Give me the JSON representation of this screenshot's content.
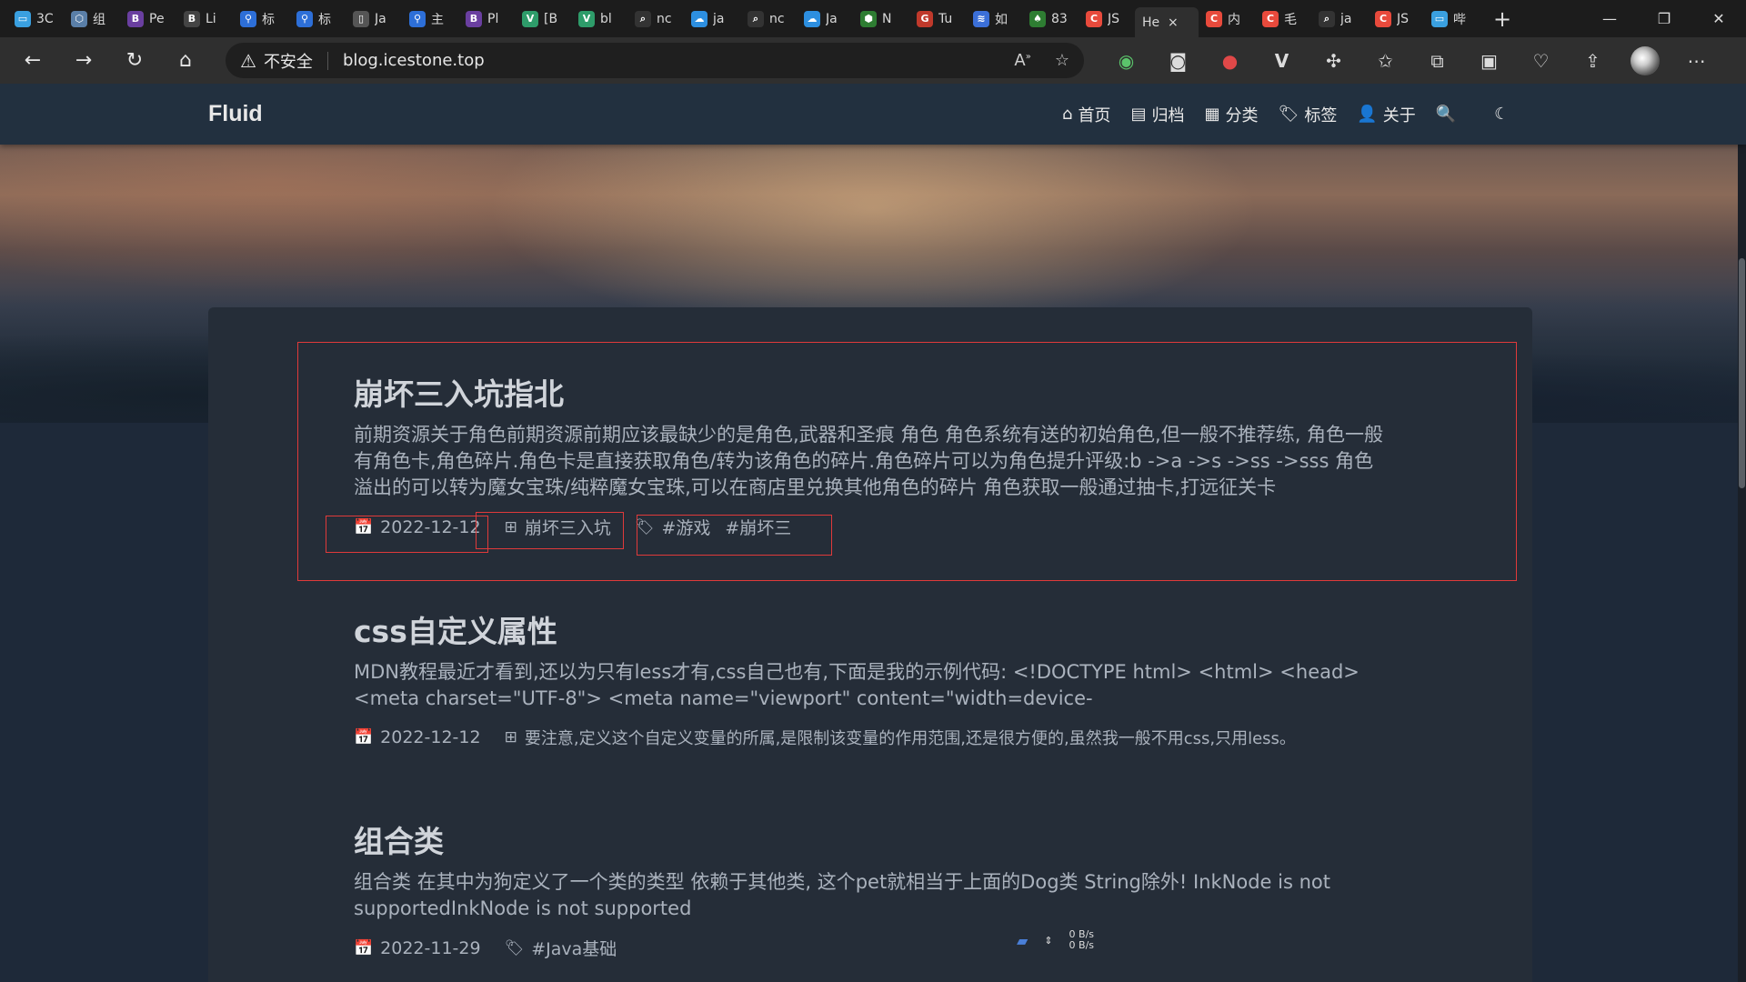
{
  "tabs": [
    {
      "label": "3C",
      "icon": "bilibili-icon",
      "color": "#3aa0e0"
    },
    {
      "label": "组",
      "icon": "cube-icon",
      "color": "#5a7fa8"
    },
    {
      "label": "Pe",
      "icon": "b-icon",
      "color": "#6a3fa0"
    },
    {
      "label": "Li",
      "icon": "b-icon",
      "color": "#444"
    },
    {
      "label": "标",
      "icon": "rocket-icon",
      "color": "#2d6fd8"
    },
    {
      "label": "标",
      "icon": "rocket-icon",
      "color": "#2d6fd8"
    },
    {
      "label": "Ja",
      "icon": "doc-icon",
      "color": "#555"
    },
    {
      "label": "主",
      "icon": "rocket-icon",
      "color": "#2d6fd8"
    },
    {
      "label": "Pl",
      "icon": "b-icon",
      "color": "#6a3fa0"
    },
    {
      "label": "[B",
      "icon": "vue-icon",
      "color": "#2e9c6a"
    },
    {
      "label": "bl",
      "icon": "vue-icon",
      "color": "#2e9c6a"
    },
    {
      "label": "nc",
      "icon": "search-icon",
      "color": "#333"
    },
    {
      "label": "ja",
      "icon": "cloud-icon",
      "color": "#2d8fe0"
    },
    {
      "label": "nc",
      "icon": "search-icon",
      "color": "#333"
    },
    {
      "label": "Ja",
      "icon": "cloud-icon",
      "color": "#2d8fe0"
    },
    {
      "label": "N",
      "icon": "shield-icon",
      "color": "#2e7d32"
    },
    {
      "label": "Tu",
      "icon": "g-icon",
      "color": "#c0392b"
    },
    {
      "label": "如",
      "icon": "layers-icon",
      "color": "#3b6fd8"
    },
    {
      "label": "83",
      "icon": "leaf-icon",
      "color": "#2e7d32"
    },
    {
      "label": "JS",
      "icon": "csdn-icon",
      "color": "#e84a3c"
    }
  ],
  "active_tab": {
    "label": "He",
    "close": "×"
  },
  "tabs_after": [
    {
      "label": "内",
      "icon": "csdn-icon",
      "color": "#e84a3c"
    },
    {
      "label": "毛",
      "icon": "csdn-icon",
      "color": "#e84a3c"
    },
    {
      "label": "ja",
      "icon": "search-icon",
      "color": "#333"
    },
    {
      "label": "JS",
      "icon": "csdn-icon",
      "color": "#e84a3c"
    },
    {
      "label": "哔",
      "icon": "bilibili-icon",
      "color": "#3aa0e0"
    }
  ],
  "new_tab": "+",
  "window": {
    "minimize": "—",
    "restore": "❐",
    "close": "✕"
  },
  "toolbar": {
    "back": "←",
    "forward": "→",
    "reload": "↻",
    "home": "⌂",
    "security_warning": "不安全",
    "url": "blog.icestone.top"
  },
  "site": {
    "brand": "Fluid",
    "nav": [
      {
        "label": "首页",
        "icon": "home-icon",
        "glyph": "⌂"
      },
      {
        "label": "归档",
        "icon": "archive-icon",
        "glyph": "▤"
      },
      {
        "label": "分类",
        "icon": "grid-icon",
        "glyph": "▦"
      },
      {
        "label": "标签",
        "icon": "tags-icon",
        "glyph": "🏷"
      },
      {
        "label": "关于",
        "icon": "user-icon",
        "glyph": "👤"
      }
    ],
    "search_glyph": "🔍",
    "theme_glyph": "☾"
  },
  "posts": [
    {
      "title": "崩坏三入坑指北",
      "excerpt": "前期资源关于角色前期资源前期应该最缺少的是角色,武器和圣痕 角色 角色系统有送的初始角色,但一般不推荐练, 角色一般有角色卡,角色碎片.角色卡是直接获取角色/转为该角色的碎片.角色碎片可以为角色提升评级:b ->a ->s ->ss ->sss 角色溢出的可以转为魔女宝珠/纯粹魔女宝珠,可以在商店里兑换其他角色的碎片 角色获取一般通过抽卡,打远征关卡",
      "date": "2022-12-12",
      "category": "崩坏三入坑",
      "tags": [
        "#游戏",
        "#崩坏三"
      ]
    },
    {
      "title": "css自定义属性",
      "excerpt": "MDN教程最近才看到,还以为只有less才有,css自己也有,下面是我的示例代码: <!DOCTYPE html> <html> <head> <meta charset=\"UTF-8\"> <meta name=\"viewport\" content=\"width=device-",
      "date": "2022-12-12",
      "category": "要注意,定义这个自定义变量的所属,是限制该变量的作用范围,还是很方便的,虽然我一般不用css,只用less。"
    },
    {
      "title": "组合类",
      "excerpt": "组合类 在其中为狗定义了一个类的类型 依赖于其他类, 这个pet就相当于上面的Dog类 String除外! InkNode is not supportedInkNode is not supported",
      "date": "2022-11-29",
      "tags": [
        "#Java基础"
      ]
    }
  ],
  "netspeed": {
    "up": "0 B/s",
    "down": "0 B/s"
  },
  "colors": {
    "highlight": "#e03a3a",
    "navbar": "#22303f",
    "board": "#252d38"
  }
}
